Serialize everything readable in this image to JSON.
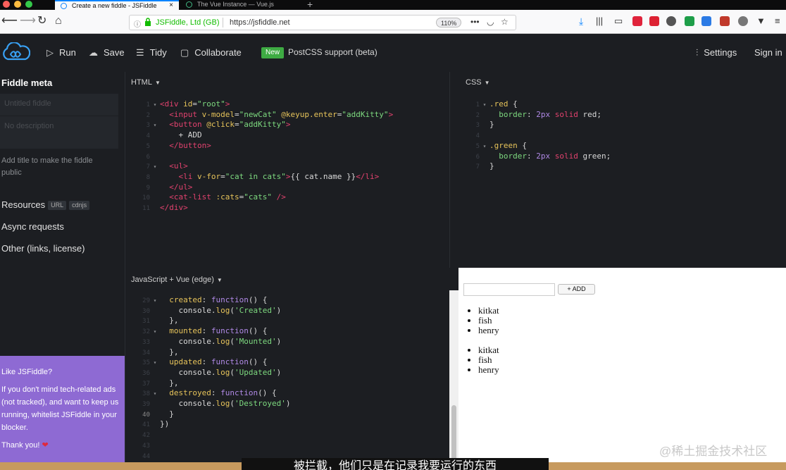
{
  "browser": {
    "tabs": [
      {
        "title": "Create a new fiddle - JSFiddle",
        "active": true
      },
      {
        "title": "The Vue Instance — Vue.js",
        "active": false
      }
    ],
    "url": {
      "identity": "JSFiddle, Ltd (GB)",
      "address": "https://jsfiddle.net",
      "zoom": "110%"
    }
  },
  "header": {
    "run_label": "Run",
    "save_label": "Save",
    "tidy_label": "Tidy",
    "collaborate_label": "Collaborate",
    "badge_label": "New",
    "announcement": "PostCSS support (beta)",
    "settings_label": "Settings",
    "signin_label": "Sign in"
  },
  "sidebar": {
    "title": "Fiddle meta",
    "title_placeholder": "Untitled fiddle",
    "description_placeholder": "No description",
    "hint": "Add title to make the fiddle public",
    "resources_label": "Resources",
    "resources_tags": [
      "URL",
      "cdnjs"
    ],
    "async_label": "Async requests",
    "other_label": "Other (links, license)"
  },
  "promo": {
    "title": "Like JSFiddle?",
    "body": "If you don't mind tech-related ads (not tracked), and want to keep us running, whitelist JSFiddle in your blocker.",
    "thanks": "Thank you!"
  },
  "panels": {
    "html_label": "HTML",
    "css_label": "CSS",
    "js_label": "JavaScript + Vue (edge)"
  },
  "preview": {
    "button_label": "+ ADD",
    "list1": [
      "kitkat",
      "fish",
      "henry"
    ],
    "list2": [
      "kitkat",
      "fish",
      "henry"
    ]
  },
  "overlay": {
    "subtitle": "被拦截，他们只是在记录我要运行的东西",
    "watermark": "@稀土掘金技术社区"
  }
}
